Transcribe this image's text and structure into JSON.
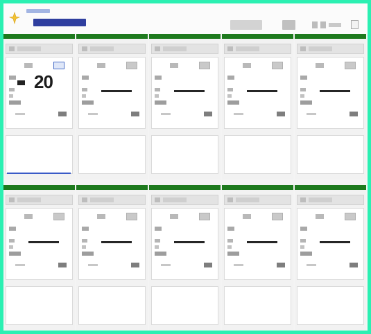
{
  "header": {
    "brand_primary": "",
    "brand_secondary": "",
    "selector_value": "",
    "page_label": ""
  },
  "panels": [
    {
      "title": "",
      "value": "20"
    },
    {
      "title": "",
      "value": ""
    },
    {
      "title": "",
      "value": ""
    },
    {
      "title": "",
      "value": ""
    },
    {
      "title": "",
      "value": ""
    },
    {
      "title": "",
      "value": ""
    },
    {
      "title": "",
      "value": ""
    },
    {
      "title": "",
      "value": ""
    },
    {
      "title": "",
      "value": ""
    },
    {
      "title": "",
      "value": ""
    }
  ],
  "colors": {
    "border": "#2bf0b2",
    "accent_green": "#1e7a1e",
    "brand_blue": "#2f3f9f",
    "selection_blue": "#3a5bc7"
  }
}
